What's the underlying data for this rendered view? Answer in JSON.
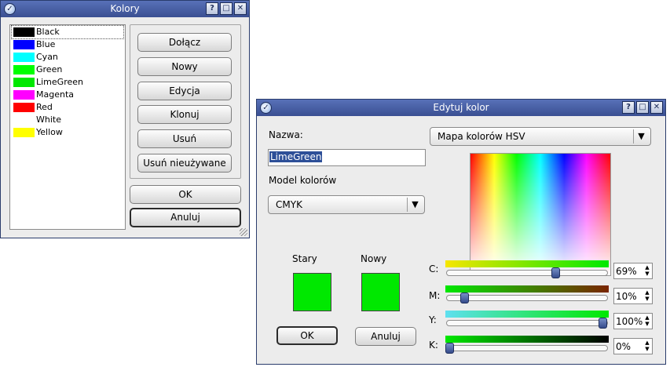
{
  "kolory": {
    "title": "Kolory",
    "colors": [
      {
        "name": "Black",
        "swatch": "#000000"
      },
      {
        "name": "Blue",
        "swatch": "#0000ff"
      },
      {
        "name": "Cyan",
        "swatch": "#00ffff"
      },
      {
        "name": "Green",
        "swatch": "#00ff00"
      },
      {
        "name": "LimeGreen",
        "swatch": "#00e800"
      },
      {
        "name": "Magenta",
        "swatch": "#ff00ff"
      },
      {
        "name": "Red",
        "swatch": "#ff0000"
      },
      {
        "name": "White",
        "swatch": "#ffffff"
      },
      {
        "name": "Yellow",
        "swatch": "#ffff00"
      }
    ],
    "buttons": {
      "append": "Dołącz",
      "new": "Nowy",
      "edit": "Edycja",
      "clone": "Klonuj",
      "delete": "Usuń",
      "delete_unused": "Usuń nieużywane",
      "ok": "OK",
      "cancel": "Anuluj"
    }
  },
  "edytuj": {
    "title": "Edytuj kolor",
    "name_label": "Nazwa:",
    "name_value": "LimeGreen",
    "model_label": "Model kolorów",
    "model_value": "CMYK",
    "map_value": "Mapa kolorów HSV",
    "old_label": "Stary",
    "new_label": "Nowy",
    "old_color": "#00e800",
    "new_color": "#00e800",
    "ok": "OK",
    "cancel": "Anuluj",
    "sliders": [
      {
        "label": "C:",
        "value_text": "69%",
        "value": 0.69
      },
      {
        "label": "M:",
        "value_text": "10%",
        "value": 0.1
      },
      {
        "label": "Y:",
        "value_text": "100%",
        "value": 1.0
      },
      {
        "label": "K:",
        "value_text": "0%",
        "value": 0.0
      }
    ]
  },
  "titlebar_buttons": {
    "help": "?",
    "maximize": "□",
    "close": "✕"
  }
}
